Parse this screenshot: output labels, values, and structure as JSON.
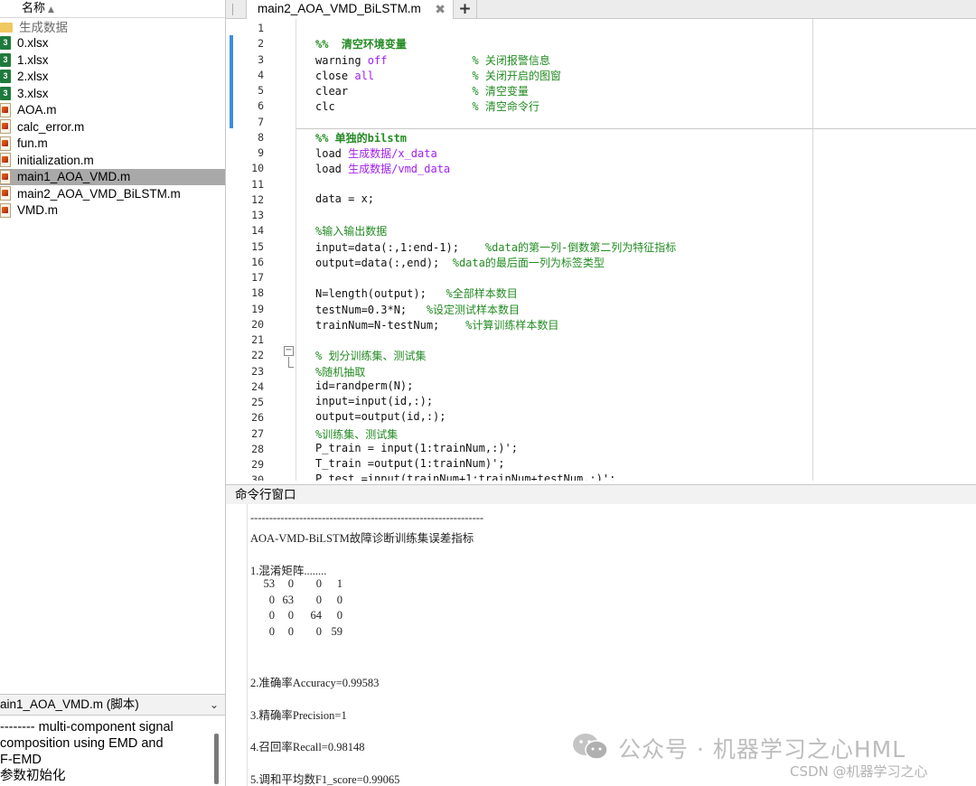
{
  "file_browser": {
    "column_header": "名称",
    "files": [
      {
        "name": "生成数据",
        "type": "folder"
      },
      {
        "name": "0.xlsx",
        "type": "xlsx"
      },
      {
        "name": "1.xlsx",
        "type": "xlsx"
      },
      {
        "name": "2.xlsx",
        "type": "xlsx"
      },
      {
        "name": "3.xlsx",
        "type": "xlsx"
      },
      {
        "name": "AOA.m",
        "type": "m"
      },
      {
        "name": "calc_error.m",
        "type": "m"
      },
      {
        "name": "fun.m",
        "type": "m"
      },
      {
        "name": "initialization.m",
        "type": "m"
      },
      {
        "name": "main1_AOA_VMD.m",
        "type": "m",
        "selected": true
      },
      {
        "name": "main2_AOA_VMD_BiLSTM.m",
        "type": "m"
      },
      {
        "name": "VMD.m",
        "type": "m"
      }
    ],
    "details_title": "ain1_AOA_VMD.m (脚本)",
    "details_lines": [
      "-------- multi-component signal",
      "composition using EMD and",
      "F-EMD",
      "参数初始化"
    ]
  },
  "editor": {
    "tab_label": "main2_AOA_VMD_BiLSTM.m",
    "tab_close": "✖",
    "add_tab": "+",
    "fold_symbol": "−",
    "lines": [
      {
        "n": "1",
        "segs": []
      },
      {
        "n": "2",
        "segs": [
          [
            "cmb",
            "%%  清空环境变量"
          ]
        ]
      },
      {
        "n": "3",
        "segs": [
          [
            "",
            "warning "
          ],
          [
            "kw",
            "off"
          ],
          [
            "",
            "             "
          ],
          [
            "cm",
            "% 关闭报警信息"
          ]
        ]
      },
      {
        "n": "4",
        "segs": [
          [
            "",
            "close "
          ],
          [
            "kw",
            "all"
          ],
          [
            "",
            "               "
          ],
          [
            "cm",
            "% 关闭开启的图窗"
          ]
        ]
      },
      {
        "n": "5",
        "segs": [
          [
            "",
            "clear                   "
          ],
          [
            "cm",
            "% 清空变量"
          ]
        ]
      },
      {
        "n": "6",
        "segs": [
          [
            "",
            "clc                     "
          ],
          [
            "cm",
            "% 清空命令行"
          ]
        ]
      },
      {
        "n": "7",
        "segs": []
      },
      {
        "n": "8",
        "segs": [
          [
            "cmb",
            "%% 单独的bilstm"
          ]
        ]
      },
      {
        "n": "9",
        "segs": [
          [
            "",
            "load "
          ],
          [
            "str",
            "生成数据/x_data"
          ]
        ]
      },
      {
        "n": "10",
        "segs": [
          [
            "",
            "load "
          ],
          [
            "str",
            "生成数据/vmd_data"
          ]
        ]
      },
      {
        "n": "11",
        "segs": []
      },
      {
        "n": "12",
        "segs": [
          [
            "",
            "data = x;"
          ]
        ]
      },
      {
        "n": "13",
        "segs": []
      },
      {
        "n": "14",
        "segs": [
          [
            "cm",
            "%输入输出数据"
          ]
        ]
      },
      {
        "n": "15",
        "segs": [
          [
            "",
            "input=data(:,1:end-1);    "
          ],
          [
            "cm",
            "%data的第一列-倒数第二列为特征指标"
          ]
        ]
      },
      {
        "n": "16",
        "segs": [
          [
            "",
            "output=data(:,end);  "
          ],
          [
            "cm",
            "%data的最后面一列为标签类型"
          ]
        ]
      },
      {
        "n": "17",
        "segs": []
      },
      {
        "n": "18",
        "segs": [
          [
            "",
            "N=length(output);   "
          ],
          [
            "cm",
            "%全部样本数目"
          ]
        ]
      },
      {
        "n": "19",
        "segs": [
          [
            "",
            "testNum=0.3*N;   "
          ],
          [
            "cm",
            "%设定测试样本数目"
          ]
        ]
      },
      {
        "n": "20",
        "segs": [
          [
            "",
            "trainNum=N-testNum;    "
          ],
          [
            "cm",
            "%计算训练样本数目"
          ]
        ]
      },
      {
        "n": "21",
        "segs": []
      },
      {
        "n": "22",
        "segs": [
          [
            "cm",
            "% 划分训练集、测试集"
          ]
        ]
      },
      {
        "n": "23",
        "segs": [
          [
            "cm",
            "%随机抽取"
          ]
        ]
      },
      {
        "n": "24",
        "segs": [
          [
            "",
            "id=randperm(N);"
          ]
        ]
      },
      {
        "n": "25",
        "segs": [
          [
            "",
            "input=input(id,:);"
          ]
        ]
      },
      {
        "n": "26",
        "segs": [
          [
            "",
            "output=output(id,:);"
          ]
        ]
      },
      {
        "n": "27",
        "segs": [
          [
            "cm",
            "%训练集、测试集"
          ]
        ]
      },
      {
        "n": "28",
        "segs": [
          [
            "",
            "P_train = input(1:trainNum,:)';"
          ]
        ]
      },
      {
        "n": "29",
        "segs": [
          [
            "",
            "T_train =output(1:trainNum)';"
          ]
        ]
      },
      {
        "n": "30",
        "segs": [
          [
            "",
            "P_test =input(trainNum+1:trainNum+testNum,:)';"
          ]
        ]
      }
    ]
  },
  "command_window": {
    "title": "命令行窗口",
    "separator": "--------------------------------------------------------------",
    "heading": "AOA-VMD-BiLSTM故障诊断训练集误差指标",
    "confusion_label": "1.混淆矩阵........",
    "confusion_matrix": [
      [
        53,
        0,
        0,
        1
      ],
      [
        0,
        63,
        0,
        0
      ],
      [
        0,
        0,
        64,
        0
      ],
      [
        0,
        0,
        0,
        59
      ]
    ],
    "accuracy": "2.准确率Accuracy=0.99583",
    "precision": "3.精确率Precision=1",
    "recall": "4.召回率Recall=0.98148",
    "f1": "5.调和平均数F1_score=0.99065"
  },
  "watermark": {
    "text": "公众号 · 机器学习之心HML",
    "csdn": "CSDN @机器学习之心"
  }
}
